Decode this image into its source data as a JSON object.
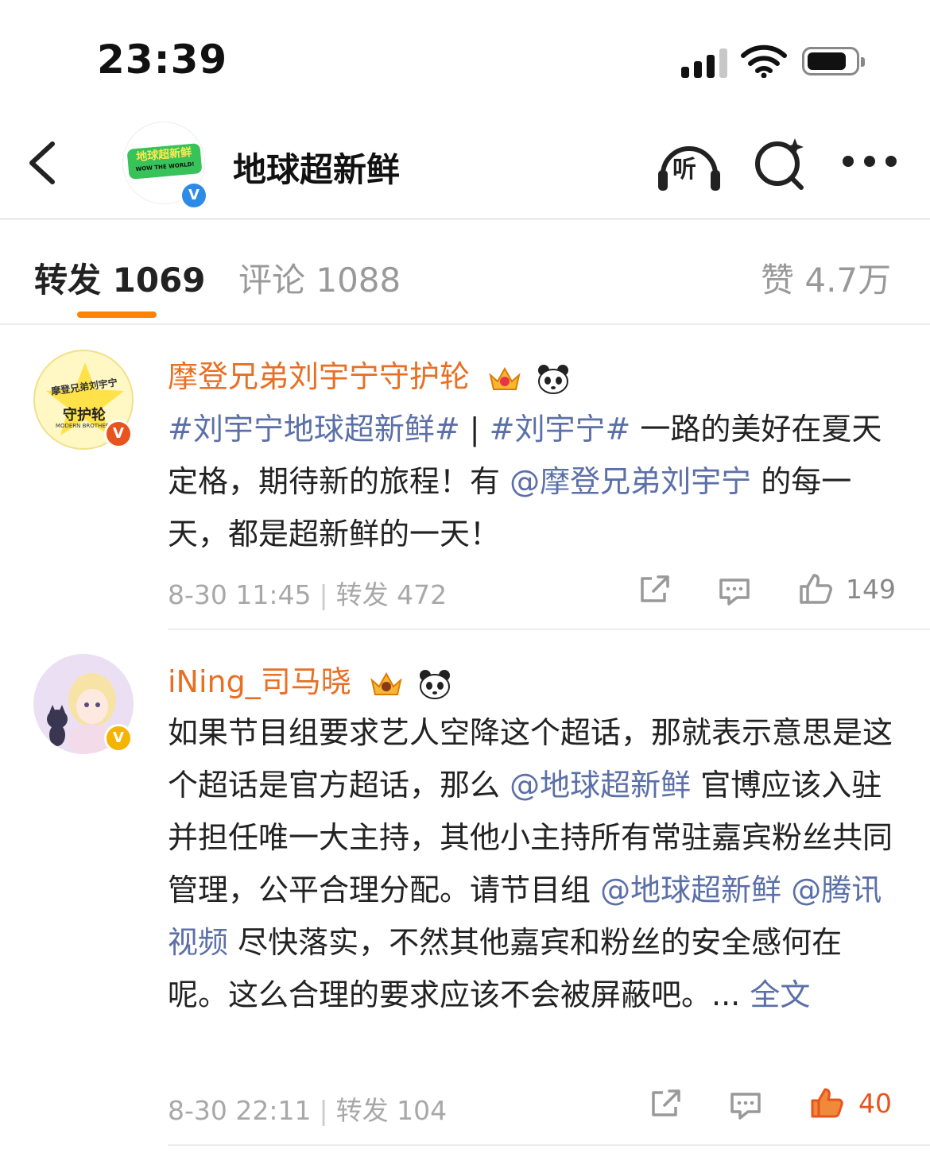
{
  "status_bar": {
    "time": "23:39"
  },
  "header": {
    "title": "地球超新鲜",
    "avatar_logo_text": "地球超新鲜",
    "avatar_logo_sub": "WOW THE WORLD!",
    "avatar_badge": "V",
    "listen_label": "听"
  },
  "tabs": [
    {
      "label": "转发 1069",
      "active": true
    },
    {
      "label": "评论 1088",
      "active": false
    },
    {
      "label": "赞 4.7万",
      "active": false
    }
  ],
  "colors": {
    "accent": "#ff8200",
    "username": "#e86f23",
    "link": "#5b6fa8",
    "badge_red": "#e8541e",
    "badge_gold": "#f4b400"
  },
  "posts": [
    {
      "username": "摩登兄弟刘宇宁守护轮",
      "avatar_text": "守护轮",
      "avatar_sub": "MODERN BROTHERS",
      "avatar_top": "摩登兄弟刘宇宁",
      "avatar_badge": "V",
      "content": [
        {
          "t": "#刘宇宁地球超新鲜#",
          "link": true
        },
        {
          "t": " | ",
          "link": false
        },
        {
          "t": "#刘宇宁#",
          "link": true
        },
        {
          "t": " 一路的美好在夏天定格，期待新的旅程！有 ",
          "link": false
        },
        {
          "t": "@摩登兄弟刘宇宁",
          "link": true
        },
        {
          "t": " 的每一天，都是超新鲜的一天！",
          "link": false
        }
      ],
      "time": "8-30 11:45",
      "repost_label": "转发 472",
      "likes": "149"
    },
    {
      "username": "iNing_司马晓",
      "avatar_badge": "V",
      "content": [
        {
          "t": "如果节目组要求艺人空降这个超话，那就表示意思是这个超话是官方超话，那么 ",
          "link": false
        },
        {
          "t": "@地球超新鲜",
          "link": true
        },
        {
          "t": " 官博应该入驻并担任唯一大主持，其他小主持所有常驻嘉宾粉丝共同管理，公平合理分配。请节目组 ",
          "link": false
        },
        {
          "t": "@地球超新鲜",
          "link": true
        },
        {
          "t": " ",
          "link": false
        },
        {
          "t": "@腾讯视频",
          "link": true
        },
        {
          "t": " 尽快落实，不然其他嘉宾和粉丝的安全感何在呢。这么合理的要求应该不会被屏蔽吧。... ",
          "link": false
        },
        {
          "t": "全文",
          "link": true
        }
      ],
      "time": "8-30 22:11",
      "repost_label": "转发 104",
      "likes": "40"
    }
  ]
}
